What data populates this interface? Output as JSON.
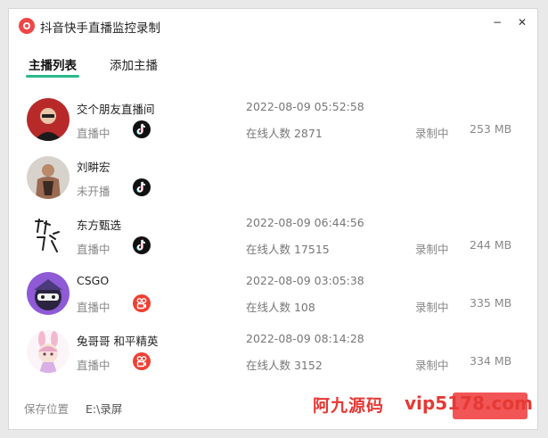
{
  "app": {
    "title": "抖音快手直播监控录制",
    "window_controls": {
      "minimize": "−",
      "close": "✕"
    }
  },
  "tabs": [
    {
      "label": "主播列表",
      "active": true
    },
    {
      "label": "添加主播",
      "active": false
    }
  ],
  "streamers": [
    {
      "name": "交个朋友直播间",
      "status": "直播中",
      "platform_icon": "tiktok-icon",
      "time": "2022-08-09 05:52:58",
      "viewers": "在线人数 2871",
      "recording": "录制中",
      "size": "253 MB",
      "avatar_color": "#b83030"
    },
    {
      "name": "刘畊宏",
      "status": "未开播",
      "platform_icon": "tiktok-icon",
      "time": "",
      "viewers": "",
      "recording": "",
      "size": "",
      "avatar_color": "#7a6a5a"
    },
    {
      "name": "东方甄选",
      "status": "直播中",
      "platform_icon": "tiktok-icon",
      "time": "2022-08-09 06:44:56",
      "viewers": "在线人数 17515",
      "recording": "录制中",
      "size": "244 MB",
      "avatar_color": "#ffffff"
    },
    {
      "name": "CSGO",
      "status": "直播中",
      "platform_icon": "kuaishou-icon",
      "time": "2022-08-09 03:05:38",
      "viewers": "在线人数 108",
      "recording": "录制中",
      "size": "335 MB",
      "avatar_color": "#8e5ad6"
    },
    {
      "name": "兔哥哥 和平精英",
      "status": "直播中",
      "platform_icon": "kuaishou-icon",
      "time": "2022-08-09 08:14:28",
      "viewers": "在线人数 3152",
      "recording": "录制中",
      "size": "334 MB",
      "avatar_color": "#f4e6f0"
    }
  ],
  "footer": {
    "save_label": "保存位置",
    "save_path": "E:\\录屏"
  },
  "watermark": {
    "text": "阿九源码",
    "domain": "vip5178.com"
  },
  "colors": {
    "accent": "#29b98a",
    "live_red": "#ef4034",
    "logo_red": "#f04646"
  }
}
